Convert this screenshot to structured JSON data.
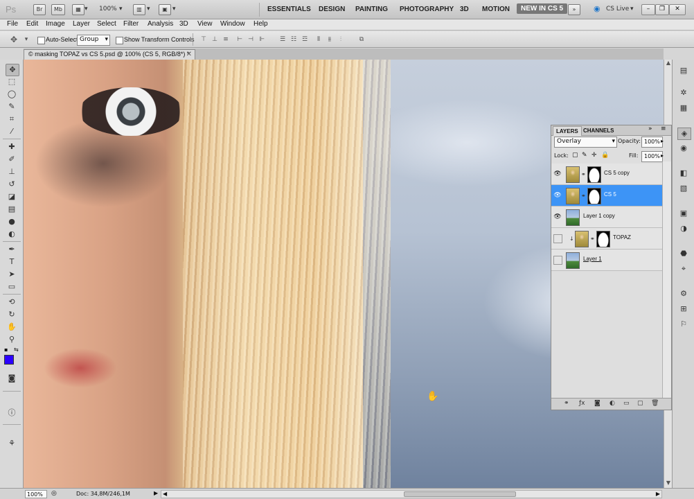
{
  "app": {
    "logo": "Ps",
    "zoom": "100%"
  },
  "workspaces": [
    "ESSENTIALS",
    "DESIGN",
    "PAINTING",
    "PHOTOGRAPHY",
    "3D",
    "MOTION",
    "NEW IN CS 5"
  ],
  "appbar": {
    "cslive": "CS Live",
    "bridge_label": "Br",
    "minibridge_label": "Mb"
  },
  "menu": [
    "File",
    "Edit",
    "Image",
    "Layer",
    "Select",
    "Filter",
    "Analysis",
    "3D",
    "View",
    "Window",
    "Help"
  ],
  "options": {
    "auto_select_label": "Auto-Select:",
    "auto_select_value": "Group",
    "transform_label": "Show Transform Controls"
  },
  "document": {
    "tab_title": "© masking TOPAZ vs CS 5.psd @ 100% (CS 5, RGB/8*) *"
  },
  "colors": {
    "foreground": "#2b00ff",
    "background": "#ffffff",
    "selection": "#3d94f6"
  },
  "layers_panel": {
    "tabs": [
      "LAYERS",
      "CHANNELS"
    ],
    "blend_mode": "Overlay",
    "opacity_label": "Opacity:",
    "opacity": "100%",
    "lock_label": "Lock:",
    "fill_label": "Fill:",
    "fill": "100%",
    "layers": [
      {
        "name": "CS 5 copy",
        "visible": true,
        "selected": false,
        "has_mask": true,
        "thumb": "portrait"
      },
      {
        "name": "CS 5",
        "visible": true,
        "selected": true,
        "has_mask": true,
        "thumb": "portrait"
      },
      {
        "name": "Layer 1 copy",
        "visible": true,
        "selected": false,
        "has_mask": false,
        "thumb": "sky"
      },
      {
        "name": "TOPAZ",
        "visible": false,
        "selected": false,
        "has_mask": true,
        "thumb": "portrait"
      },
      {
        "name": "Layer 1",
        "visible": false,
        "selected": false,
        "has_mask": false,
        "thumb": "sky"
      }
    ]
  },
  "status": {
    "zoom": "100%",
    "doc_info": "Doc: 34,8M/246,1M"
  }
}
